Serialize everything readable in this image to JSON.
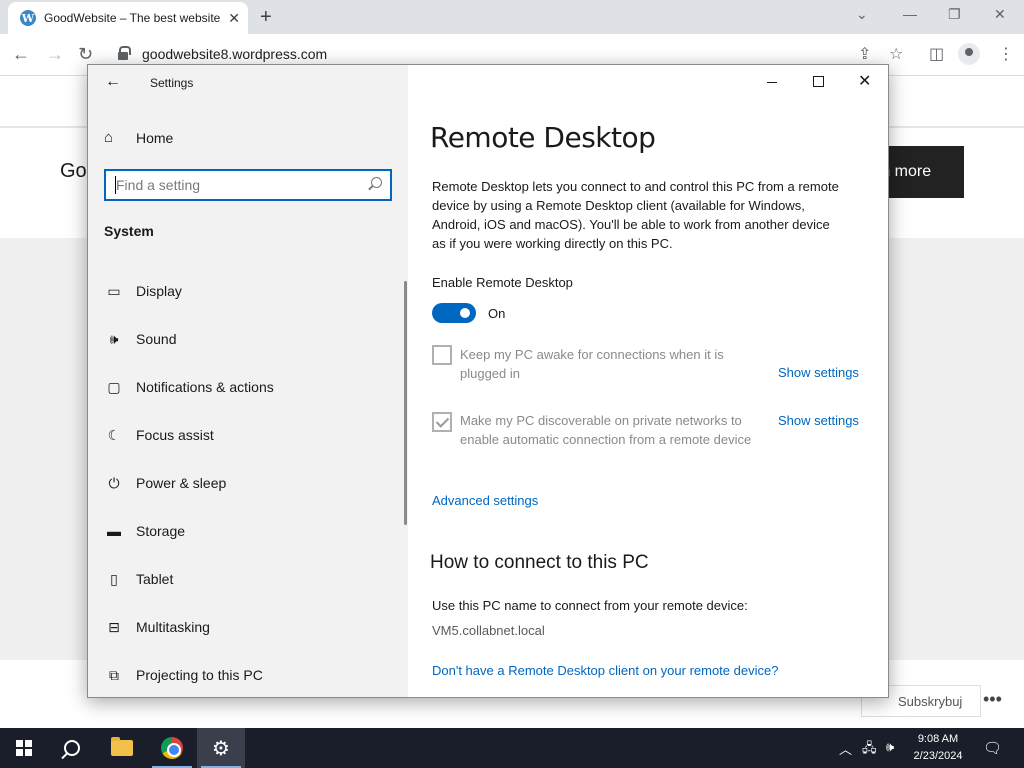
{
  "browser": {
    "tab_title": "GoodWebsite – The best website",
    "tab_favicon": "W",
    "url": "goodwebsite8.wordpress.com"
  },
  "webpage": {
    "heading_fragment": "Go",
    "cta_fragment": "rn more",
    "subscribe_label": "Subskrybuj",
    "more_label": "•••"
  },
  "settings": {
    "window_title": "Settings",
    "home_label": "Home",
    "search_placeholder": "Find a setting",
    "section_label": "System",
    "nav_items": [
      {
        "label": "Display",
        "icon": "display-icon"
      },
      {
        "label": "Sound",
        "icon": "sound-icon"
      },
      {
        "label": "Notifications & actions",
        "icon": "notifications-icon"
      },
      {
        "label": "Focus assist",
        "icon": "moon-icon"
      },
      {
        "label": "Power & sleep",
        "icon": "power-icon"
      },
      {
        "label": "Storage",
        "icon": "storage-icon"
      },
      {
        "label": "Tablet",
        "icon": "tablet-icon"
      },
      {
        "label": "Multitasking",
        "icon": "multitasking-icon"
      },
      {
        "label": "Projecting to this PC",
        "icon": "projecting-icon"
      }
    ],
    "page": {
      "title": "Remote Desktop",
      "description": "Remote Desktop lets you connect to and control this PC from a remote device by using a Remote Desktop client (available for Windows, Android, iOS and macOS). You'll be able to work from another device as if you were working directly on this PC.",
      "enable_label": "Enable Remote Desktop",
      "toggle_state": "On",
      "toggle_on": true,
      "option1": {
        "text": "Keep my PC awake for connections when it is plugged in",
        "checked": false,
        "link": "Show settings"
      },
      "option2": {
        "text": "Make my PC discoverable on private networks to enable automatic connection from a remote device",
        "checked": true,
        "link": "Show settings"
      },
      "advanced_link": "Advanced settings",
      "connect_heading": "How to connect to this PC",
      "connect_text": "Use this PC name to connect from your remote device:",
      "pc_name": "VM5.collabnet.local",
      "client_link": "Don't have a Remote Desktop client on your remote device?"
    }
  },
  "taskbar": {
    "time": "9:08 AM",
    "date": "2/23/2024",
    "colors": {
      "bar": "#1a1e2a",
      "accent": "#0067c0"
    }
  }
}
